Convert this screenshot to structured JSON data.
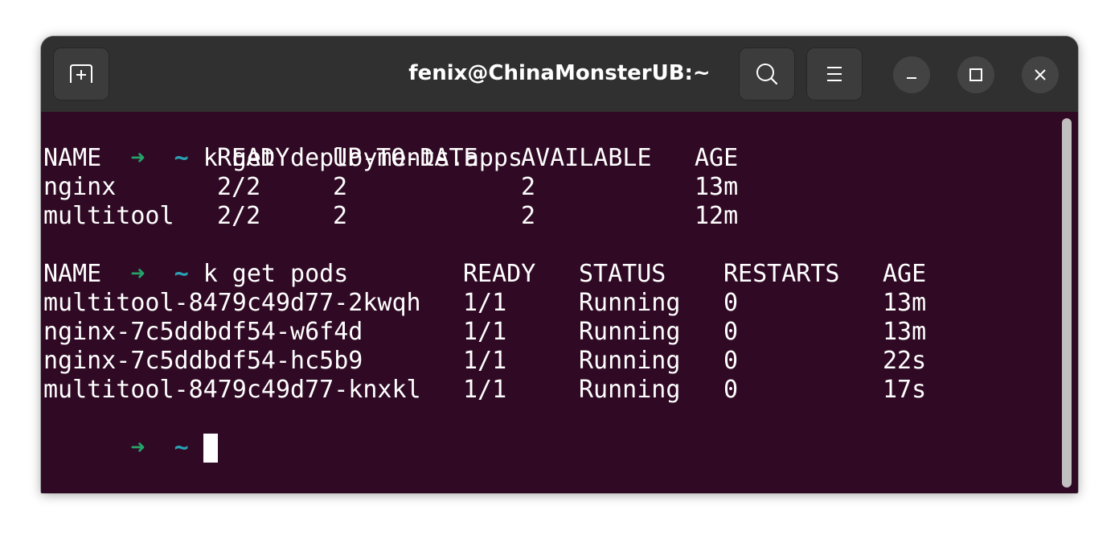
{
  "window": {
    "title": "fenix@ChinaMonsterUB:~"
  },
  "titlebar": {
    "new_tab_icon": "new-tab-icon",
    "search_icon": "search-icon",
    "menu_icon": "hamburger-menu-icon",
    "minimize_icon": "minimize-icon",
    "maximize_icon": "maximize-icon",
    "close_icon": "close-icon"
  },
  "prompt": {
    "arrow": "➜",
    "dir": "~",
    "arrow_color": "#26a269",
    "dir_color": "#2aa1b3"
  },
  "commands": [
    "k get deployments.apps",
    "k get pods"
  ],
  "deployments": {
    "headers": [
      "NAME",
      "READY",
      "UP-TO-DATE",
      "AVAILABLE",
      "AGE"
    ],
    "rows": [
      [
        "nginx",
        "2/2",
        "2",
        "2",
        "13m"
      ],
      [
        "multitool",
        "2/2",
        "2",
        "2",
        "12m"
      ]
    ]
  },
  "pods": {
    "headers": [
      "NAME",
      "READY",
      "STATUS",
      "RESTARTS",
      "AGE"
    ],
    "rows": [
      [
        "multitool-8479c49d77-2kwqh",
        "1/1",
        "Running",
        "0",
        "13m"
      ],
      [
        "nginx-7c5ddbdf54-w6f4d",
        "1/1",
        "Running",
        "0",
        "13m"
      ],
      [
        "nginx-7c5ddbdf54-hc5b9",
        "1/1",
        "Running",
        "0",
        "22s"
      ],
      [
        "multitool-8479c49d77-knxkl",
        "1/1",
        "Running",
        "0",
        "17s"
      ]
    ]
  },
  "colors": {
    "terminal_bg": "#300a24",
    "titlebar_bg": "#303030",
    "text": "#ffffff"
  }
}
